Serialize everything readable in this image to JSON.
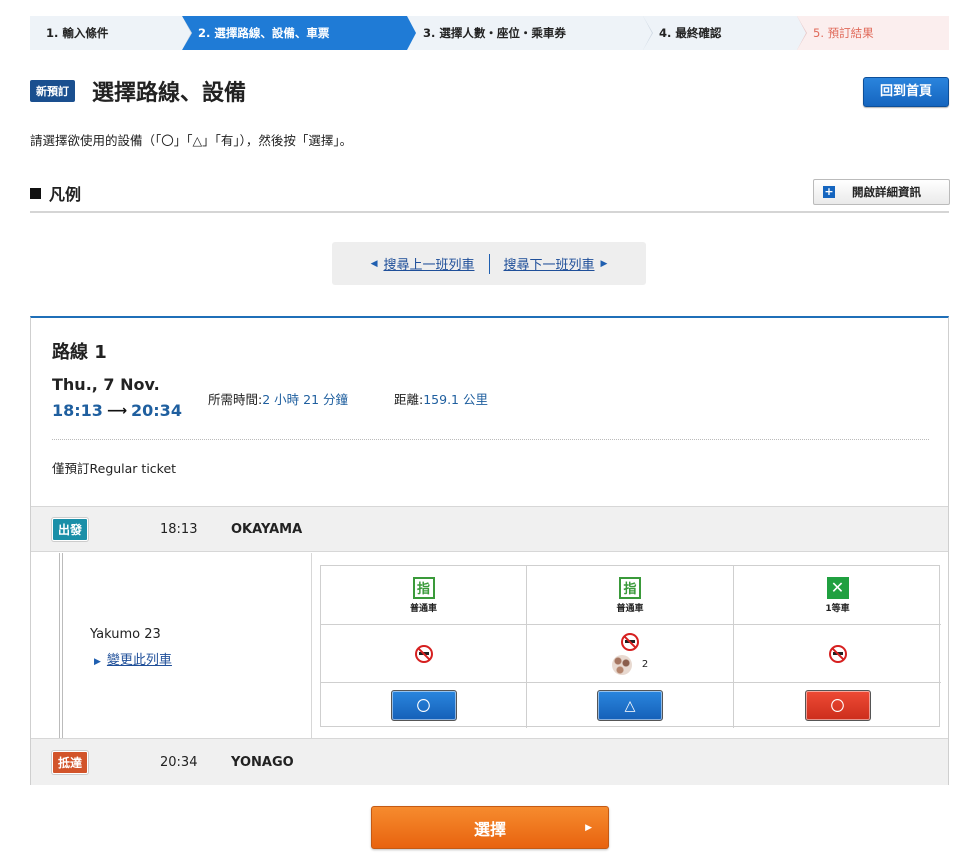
{
  "steps": [
    {
      "label": "1. 輸入條件"
    },
    {
      "label": "2. 選擇路線、設備、車票"
    },
    {
      "label": "3. 選擇人數・座位・乘車券"
    },
    {
      "label": "4. 最終確認"
    },
    {
      "label": "5. 預訂結果"
    }
  ],
  "header": {
    "badge": "新預訂",
    "title": "選擇路線、設備",
    "home_button": "回到首頁"
  },
  "instruction": "請選擇欲使用的設備（「〇」「△」「有」），然後按「選擇」。",
  "legend": {
    "title": "凡例",
    "details_button": "開啟詳細資訊",
    "details_icon": "plus-icon"
  },
  "train_nav": {
    "prev": "搜尋上一班列車",
    "next": "搜尋下一班列車"
  },
  "route": {
    "title": "路線 1",
    "date": "Thu., 7 Nov.",
    "depart_time": "18:13",
    "arrive_time": "20:34",
    "duration_label": "所需時間:",
    "duration_value": "2 小時 21 分鐘",
    "distance_label": "距離:",
    "distance_value": "159.1 公里",
    "ticket_note": "僅預訂Regular ticket",
    "departure": {
      "tag": "出發",
      "time": "18:13",
      "station": "OKAYAMA"
    },
    "arrival": {
      "tag": "抵達",
      "time": "20:34",
      "station": "YONAGO"
    },
    "train": {
      "name": "Yakumo 23",
      "change_link": "變更此列車"
    },
    "cars": [
      {
        "icon_text": "指",
        "label": "普通車",
        "extra_count": "",
        "availability": "〇",
        "button_color": "#1f6fc8"
      },
      {
        "icon_text": "指",
        "label": "普通車",
        "extra_count": "2",
        "availability": "△",
        "button_color": "#1f6fc8"
      },
      {
        "icon_text": "✕",
        "label": "1等車",
        "extra_count": "",
        "availability": "〇",
        "button_color": "#dc3b26"
      }
    ]
  },
  "select_button": "選擇"
}
